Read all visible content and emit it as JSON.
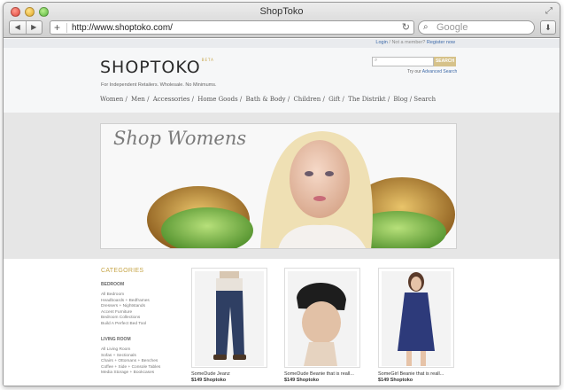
{
  "window": {
    "title": "ShopToko"
  },
  "toolbar": {
    "url": "http://www.shoptoko.com/",
    "search_placeholder": "Google",
    "back_glyph": "◀",
    "forward_glyph": "▶",
    "add_glyph": "+",
    "reload_glyph": "↻",
    "search_glyph": "⌕",
    "download_glyph": "⬇",
    "fullscreen_glyph": "⤢"
  },
  "account": {
    "login": "Login",
    "separator": "/",
    "prompt": "Not a member?",
    "register": "Register now"
  },
  "site": {
    "logo_left": "SHOP",
    "logo_right": "TOKO",
    "logo_badge": "BETA",
    "tagline": "For Independent Retailers. Wholesale. No Minimums.",
    "search_button": "SEARCH",
    "adv_prefix": "Try our",
    "adv_link": "Advanced Search"
  },
  "nav": [
    "Women /",
    "Men /",
    "Accessories /",
    "Home Goods /",
    "Bath & Body /",
    "Children /",
    "Gift /",
    "The Distrikt /",
    "Blog / Search"
  ],
  "hero": {
    "title": "Shop Womens"
  },
  "categories": {
    "title": "CATEGORIES",
    "sections": [
      {
        "name": "BEDROOM",
        "items": [
          "All Bedroom",
          "Headboards + Bedframes",
          "Dressers + Nightstands",
          "Accent Furniture",
          "Bedroom Collections",
          "Build A Perfect Bed Tool"
        ]
      },
      {
        "name": "LIVING ROOM",
        "items": [
          "All Living Room",
          "Sofas + Sectionals",
          "Chairs + Ottomans + Benches",
          "Coffee + Side + Console Tables",
          "Media Storage + Bookcases"
        ]
      }
    ]
  },
  "products": [
    {
      "name": "SomeDude Jeanz",
      "price": "$149 Shoptoko"
    },
    {
      "name": "SomeDude Beanie that is reall...",
      "price": "$149 Shoptoko"
    },
    {
      "name": "SomeGirl Beanie that is reall...",
      "price": "$149 Shoptoko"
    }
  ],
  "colors": {
    "accent": "#c7a64a",
    "link": "#3e6aa8",
    "search_button": "#d6c28a"
  }
}
